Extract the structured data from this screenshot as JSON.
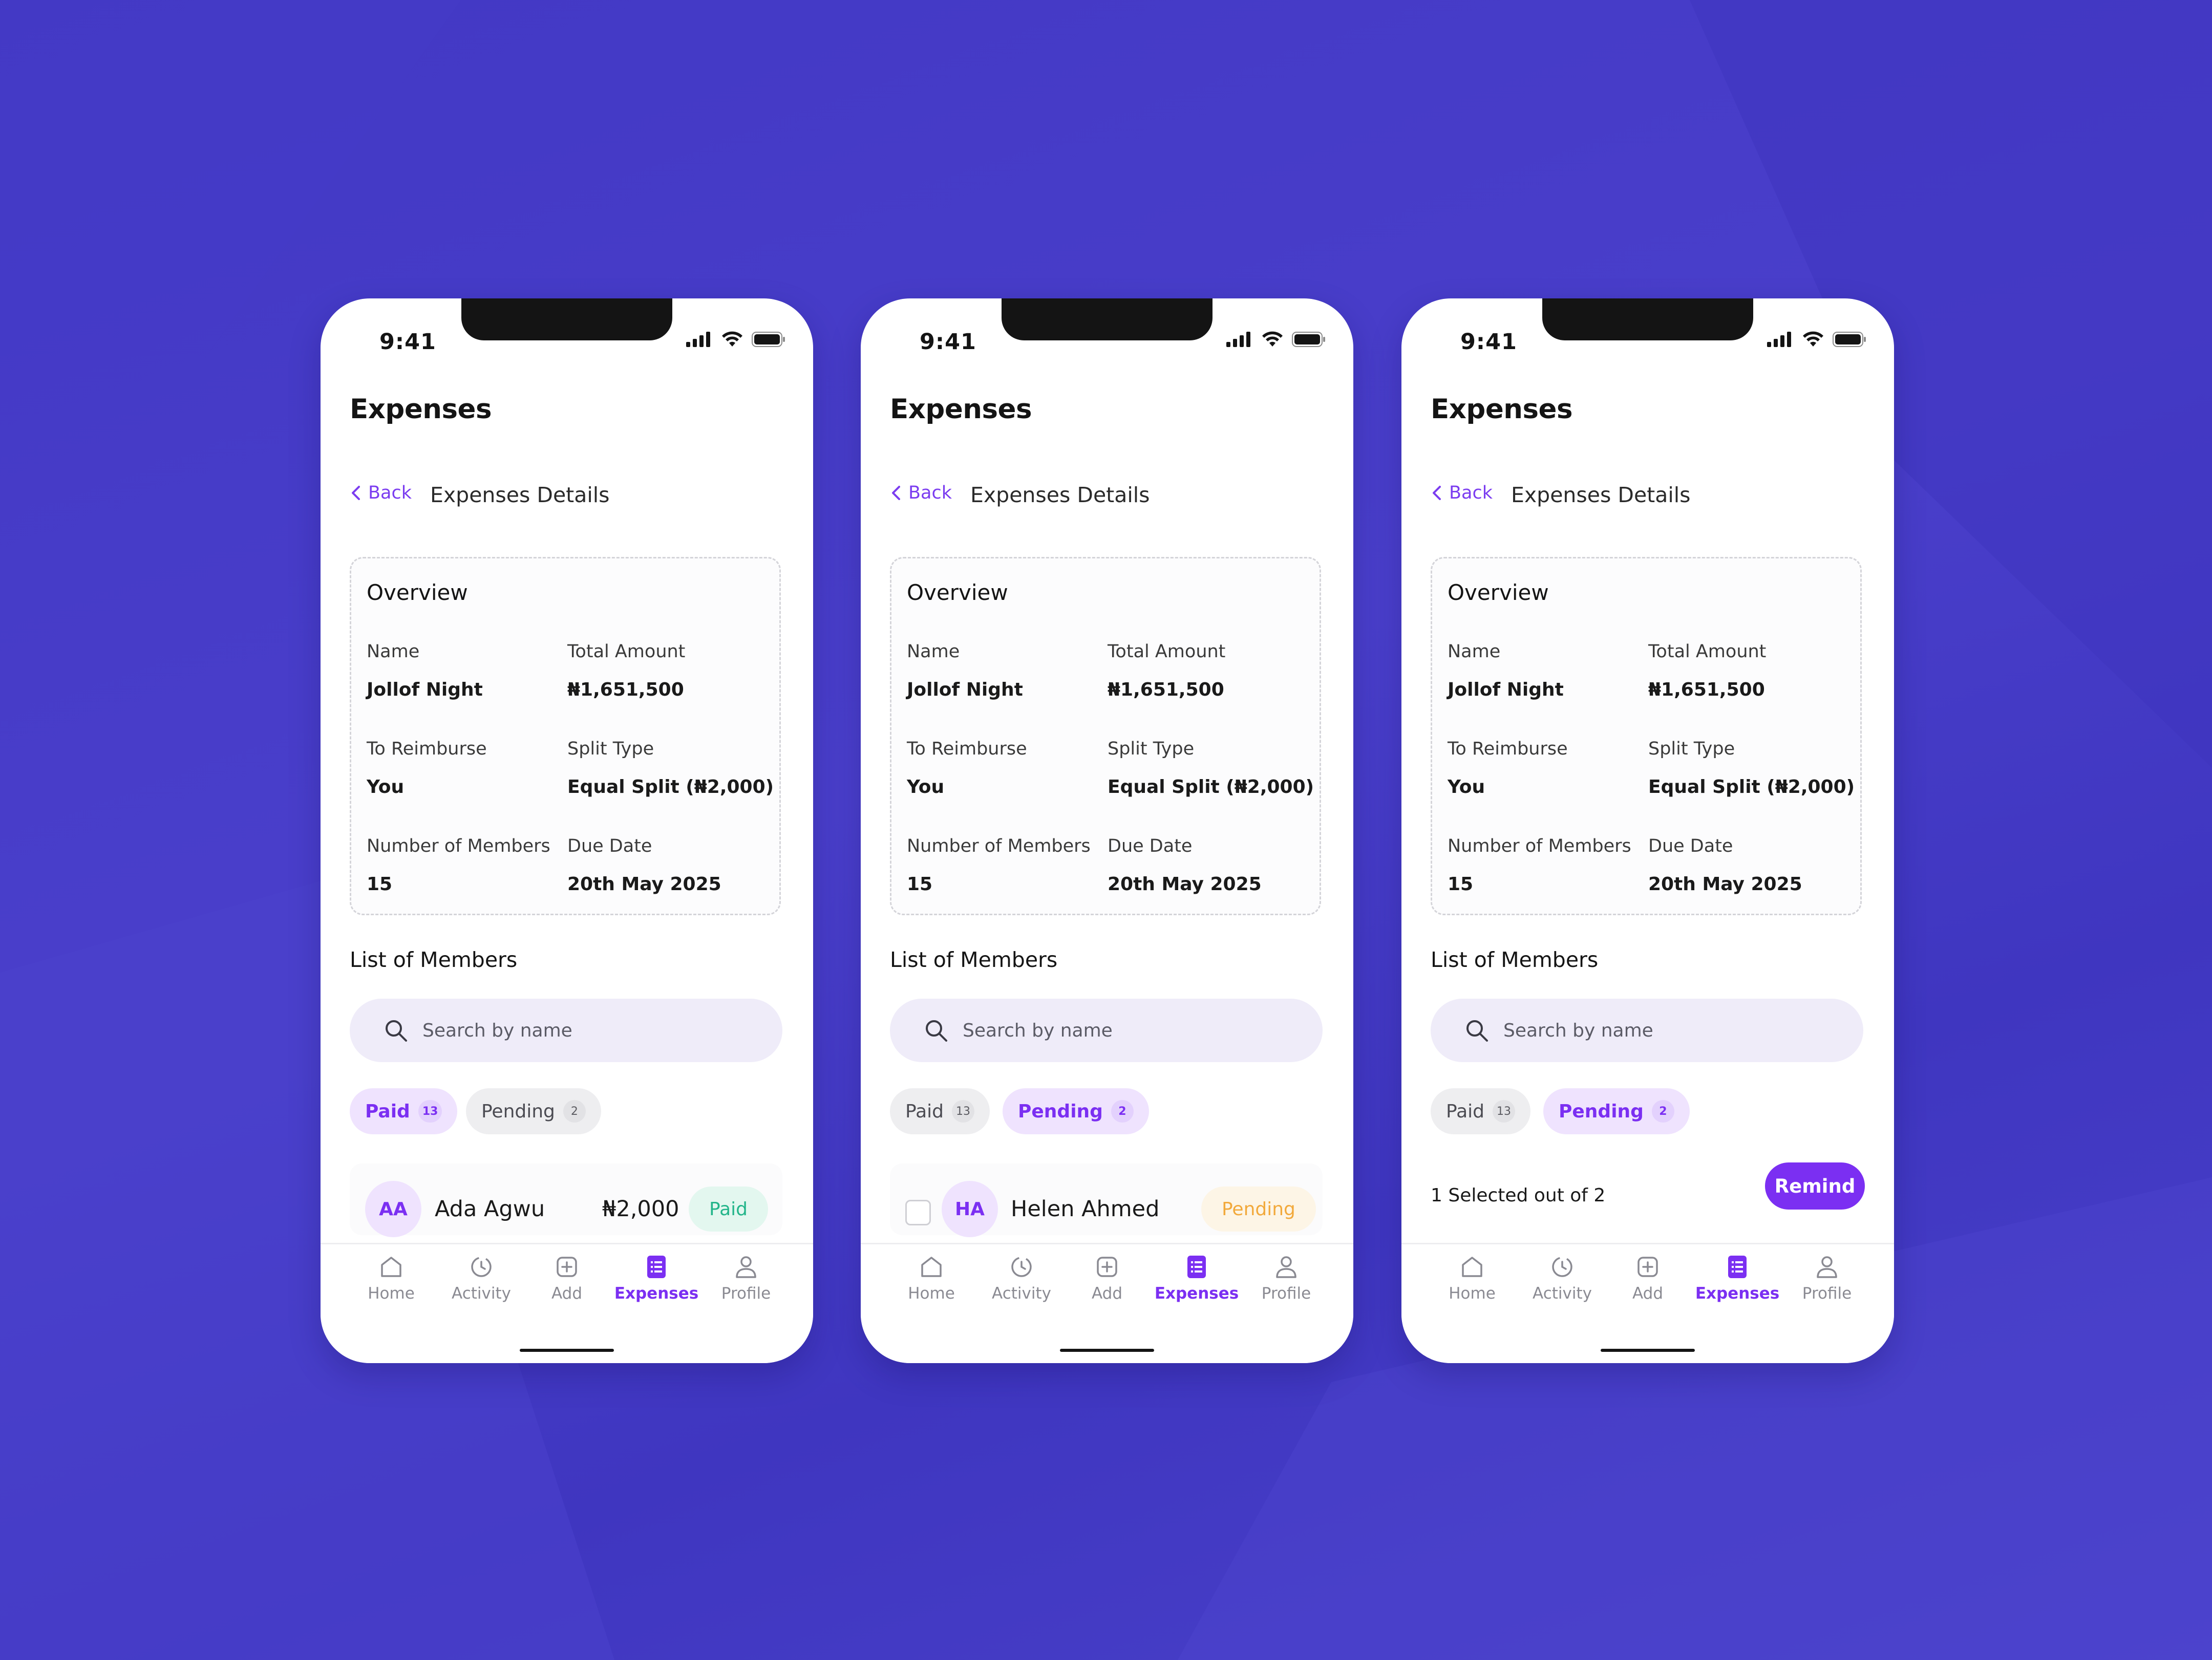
{
  "colors": {
    "accent": "#7b2ff2",
    "background": "#4238c4",
    "paid_green": "#23b58a",
    "pending_amber": "#f2a93b"
  },
  "screens": [
    {
      "status_time": "9:41",
      "title": "Expenses",
      "back_label": "Back",
      "subtitle": "Expenses Details",
      "overview": {
        "heading": "Overview",
        "name_label": "Name",
        "name_value": "Jollof Night",
        "total_label": "Total Amount",
        "total_value": "₦1,651,500",
        "reimburse_label": "To Reimburse",
        "reimburse_value": "You",
        "split_label": "Split Type",
        "split_value": "Equal Split (₦2,000)",
        "members_label": "Number of Members",
        "members_value": "15",
        "due_label": "Due Date",
        "due_value": "20th May 2025"
      },
      "list_title": "List of Members",
      "search_placeholder": "Search by name",
      "filters": [
        {
          "label": "Paid",
          "count": "13",
          "active": true
        },
        {
          "label": "Pending",
          "count": "2",
          "active": false
        }
      ],
      "member": {
        "initials": "AA",
        "name": "Ada Agwu",
        "amount": "₦2,000",
        "status": "Paid"
      },
      "tabs": [
        "Home",
        "Activity",
        "Add",
        "Expenses",
        "Profile"
      ],
      "active_tab": "Expenses"
    },
    {
      "status_time": "9:41",
      "title": "Expenses",
      "back_label": "Back",
      "subtitle": "Expenses Details",
      "overview": {
        "heading": "Overview",
        "name_label": "Name",
        "name_value": "Jollof Night",
        "total_label": "Total Amount",
        "total_value": "₦1,651,500",
        "reimburse_label": "To Reimburse",
        "reimburse_value": "You",
        "split_label": "Split Type",
        "split_value": "Equal Split (₦2,000)",
        "members_label": "Number of Members",
        "members_value": "15",
        "due_label": "Due Date",
        "due_value": "20th May 2025"
      },
      "list_title": "List of Members",
      "search_placeholder": "Search by name",
      "filters": [
        {
          "label": "Paid",
          "count": "13",
          "active": false
        },
        {
          "label": "Pending",
          "count": "2",
          "active": true
        }
      ],
      "member": {
        "initials": "HA",
        "name": "Helen Ahmed",
        "status": "Pending",
        "checked": false
      },
      "tabs": [
        "Home",
        "Activity",
        "Add",
        "Expenses",
        "Profile"
      ],
      "active_tab": "Expenses"
    },
    {
      "status_time": "9:41",
      "title": "Expenses",
      "back_label": "Back",
      "subtitle": "Expenses Details",
      "overview": {
        "heading": "Overview",
        "name_label": "Name",
        "name_value": "Jollof Night",
        "total_label": "Total Amount",
        "total_value": "₦1,651,500",
        "reimburse_label": "To Reimburse",
        "reimburse_value": "You",
        "split_label": "Split Type",
        "split_value": "Equal Split (₦2,000)",
        "members_label": "Number of Members",
        "members_value": "15",
        "due_label": "Due Date",
        "due_value": "20th May 2025"
      },
      "list_title": "List of Members",
      "search_placeholder": "Search by name",
      "filters": [
        {
          "label": "Paid",
          "count": "13",
          "active": false
        },
        {
          "label": "Pending",
          "count": "2",
          "active": true
        }
      ],
      "selection_text": "1 Selected out of 2",
      "remind_label": "Remind",
      "tabs": [
        "Home",
        "Activity",
        "Add",
        "Expenses",
        "Profile"
      ],
      "active_tab": "Expenses"
    }
  ]
}
